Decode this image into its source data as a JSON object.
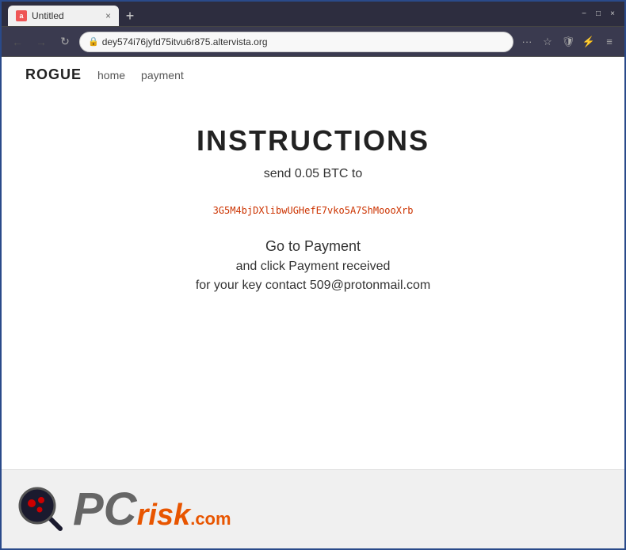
{
  "browser": {
    "tab": {
      "favicon": "a",
      "title": "Untitled",
      "close_label": "×"
    },
    "new_tab_label": "+",
    "window_controls": {
      "minimize": "−",
      "maximize": "□",
      "close": "×"
    },
    "nav": {
      "back": "←",
      "forward": "→",
      "refresh": "↻",
      "url": "dey574i76jyfd75itvu6r875.altervista.org",
      "dots": "···",
      "star": "☆",
      "shield": "🛡",
      "extensions": "⚡",
      "menu": "≡"
    }
  },
  "site": {
    "brand": "ROGUE",
    "nav_links": [
      "home",
      "payment"
    ]
  },
  "content": {
    "title": "INSTRUCTIONS",
    "subtitle": "send 0.05 BTC to",
    "btc_address": "3G5M4bjDXlibwUGHefE7vko5A7ShMoooXrb",
    "go_to_payment": "Go to Payment",
    "click_text": "and click Payment received",
    "contact_text": "for your key contact 509@protonmail.com"
  },
  "watermark": {
    "pc_text": "PC",
    "risk_text": "risk",
    "com_text": ".com"
  }
}
